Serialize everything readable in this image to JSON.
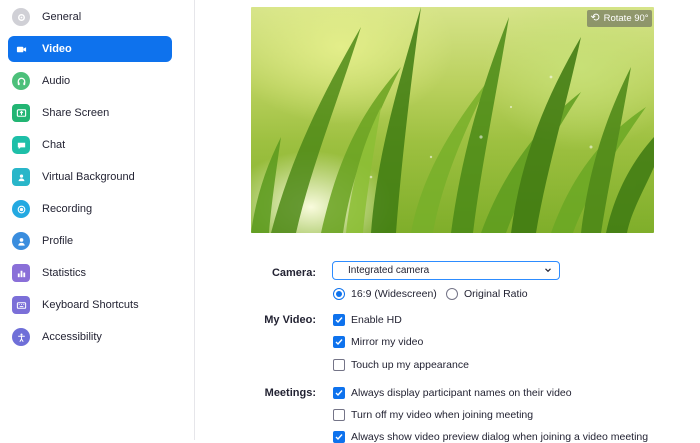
{
  "sidebar": {
    "items": [
      {
        "label": "General",
        "icon": "gear-icon",
        "color": "#c9c9cf",
        "active": false
      },
      {
        "label": "Video",
        "icon": "video-camera-icon",
        "color": "#ffffff",
        "active": true
      },
      {
        "label": "Audio",
        "icon": "headphones-icon",
        "color": "#3cb371",
        "active": false
      },
      {
        "label": "Share Screen",
        "icon": "share-screen-icon",
        "color": "#22b573",
        "active": false
      },
      {
        "label": "Chat",
        "icon": "chat-bubble-icon",
        "color": "#1ebfa8",
        "active": false
      },
      {
        "label": "Virtual Background",
        "icon": "person-frame-icon",
        "color": "#29b6c9",
        "active": false
      },
      {
        "label": "Recording",
        "icon": "record-icon",
        "color": "#24a9e1",
        "active": false
      },
      {
        "label": "Profile",
        "icon": "user-icon",
        "color": "#3a8dde",
        "active": false
      },
      {
        "label": "Statistics",
        "icon": "bar-chart-icon",
        "color": "#8a6fd8",
        "active": false
      },
      {
        "label": "Keyboard Shortcuts",
        "icon": "keyboard-icon",
        "color": "#7b6fd8",
        "active": false
      },
      {
        "label": "Accessibility",
        "icon": "accessibility-icon",
        "color": "#6f6fd8",
        "active": false
      }
    ]
  },
  "preview": {
    "rotate_label": "Rotate 90°",
    "rotate_icon": "rotate-icon"
  },
  "camera": {
    "label": "Camera:",
    "selected": "Integrated camera",
    "ratio_options": [
      {
        "label": "16:9 (Widescreen)",
        "selected": true
      },
      {
        "label": "Original Ratio",
        "selected": false
      }
    ]
  },
  "my_video": {
    "label": "My Video:",
    "options": [
      {
        "label": "Enable HD",
        "checked": true
      },
      {
        "label": "Mirror my video",
        "checked": true
      },
      {
        "label": "Touch up my appearance",
        "checked": false
      }
    ]
  },
  "meetings": {
    "label": "Meetings:",
    "options": [
      {
        "label": "Always display participant names on their video",
        "checked": true
      },
      {
        "label": "Turn off my video when joining meeting",
        "checked": false
      },
      {
        "label": "Always show video preview dialog when joining a video meeting",
        "checked": true
      }
    ]
  },
  "colors": {
    "accent": "#0e72ed",
    "select_border": "#2d8cff"
  }
}
